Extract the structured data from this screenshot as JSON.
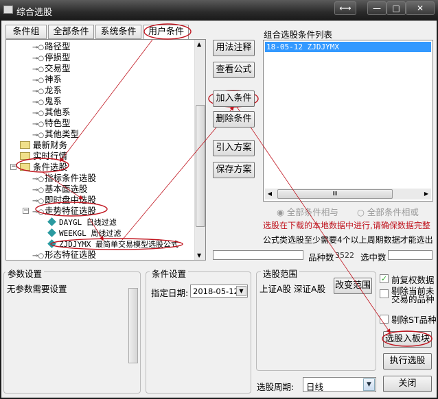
{
  "window": {
    "title": "综合选股",
    "btn_swap": "⟷",
    "btn_min": "—",
    "btn_max": "□",
    "btn_close": "✕"
  },
  "tabs": [
    {
      "label": "条件组"
    },
    {
      "label": "全部条件"
    },
    {
      "label": "系统条件"
    },
    {
      "label": "用户条件",
      "selected": true
    }
  ],
  "tree": [
    {
      "label": "路径型",
      "type": "leaf"
    },
    {
      "label": "停损型",
      "type": "leaf"
    },
    {
      "label": "交易型",
      "type": "leaf"
    },
    {
      "label": "神系",
      "type": "leaf"
    },
    {
      "label": "龙系",
      "type": "leaf"
    },
    {
      "label": "鬼系",
      "type": "leaf"
    },
    {
      "label": "其他系",
      "type": "leaf"
    },
    {
      "label": "特色型",
      "type": "leaf"
    },
    {
      "label": "其他类型",
      "type": "leaf"
    },
    {
      "label": "最新财务",
      "type": "folder"
    },
    {
      "label": "实时行情",
      "type": "folder"
    },
    {
      "label": "条件选股",
      "type": "folder-open"
    },
    {
      "label": "指标条件选股",
      "type": "leaf"
    },
    {
      "label": "基本面选股",
      "type": "leaf"
    },
    {
      "label": "即时盘中选股",
      "type": "leaf"
    },
    {
      "label": "走势特征选股",
      "type": "leaf-open"
    },
    {
      "label": "DAYGL 日线过滤",
      "type": "formula"
    },
    {
      "label": "WEEKGL 周线过滤",
      "type": "formula"
    },
    {
      "label": "ZJDJYMX 最简单交易模型选股公式",
      "type": "formula"
    },
    {
      "label": "形态特征选股",
      "type": "leaf"
    }
  ],
  "middle_buttons": [
    "用法注释",
    "查看公式",
    "加入条件",
    "删除条件",
    "引入方案",
    "保存方案"
  ],
  "combo": {
    "label": "组合选股条件列表",
    "items": [
      "18-05-12 ZJDJYMX"
    ],
    "scroll_glyph": "III"
  },
  "radios": [
    {
      "label": "全部条件相与",
      "checked": true
    },
    {
      "label": "全部条件相或",
      "checked": false
    }
  ],
  "notice_red": "选股在下载的本地数据中进行,请确保数据完整",
  "notice": "公式类选股至少需要4个以上周期数据才能选出",
  "stats": {
    "count_label": "品种数",
    "count_value": "3522",
    "selected_label": "选中数",
    "selected_value": ""
  },
  "params": {
    "title": "参数设置",
    "text": "无参数需要设置"
  },
  "cond": {
    "title": "条件设置",
    "date_label": "指定日期:",
    "date_value": "2018-05-12"
  },
  "range": {
    "title": "选股范围",
    "text": "上证A股 深证A股",
    "button": "改变范围"
  },
  "checks": [
    {
      "label": "前复权数据",
      "checked": true
    },
    {
      "label": "剔除当前未交易的品种",
      "checked": false
    },
    {
      "label": "剔除ST品种",
      "checked": false
    }
  ],
  "actions": {
    "to_block": "选股入板块",
    "run": "执行选股",
    "close": "关闭"
  },
  "period": {
    "label": "选股周期:",
    "value": "日线"
  },
  "colors": {
    "annotation": "#c0141e",
    "selection": "#3399ff",
    "warning": "#c0141e"
  }
}
